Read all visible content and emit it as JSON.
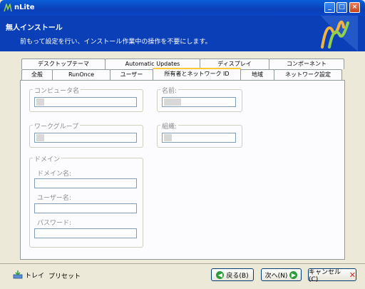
{
  "window": {
    "title": "nLite"
  },
  "header": {
    "title": "無人インストール",
    "subtitle": "前もって設定を行い、インストール作業中の操作を不要にします。"
  },
  "tabs": {
    "row1": [
      "デスクトップテーマ",
      "Automatic Updates",
      "ディスプレイ",
      "コンポーネント"
    ],
    "row2": [
      "全般",
      "RunOnce",
      "ユーザー",
      "所有者とネットワーク ID",
      "地域",
      "ネットワーク設定"
    ],
    "active": "所有者とネットワーク ID"
  },
  "owner": {
    "computer_name_label": "コンピュータ名",
    "name_label": "名前:",
    "workgroup_label": "ワークグループ",
    "organization_label": "組織:"
  },
  "domain": {
    "group_label": "ドメイン",
    "domain_name_label": "ドメイン名:",
    "username_label": "ユーザー名:",
    "password_label": "パスワード:"
  },
  "footer": {
    "tray_label": "トレイ",
    "preset_label": "プリセット",
    "back_label": "戻る(B)",
    "next_label": "次へ(N)",
    "cancel_label": "キャンセル(C)"
  },
  "colors": {
    "accent": "#0a3fb8",
    "active_tab": "#ffc83c",
    "face": "#ece9d8"
  }
}
